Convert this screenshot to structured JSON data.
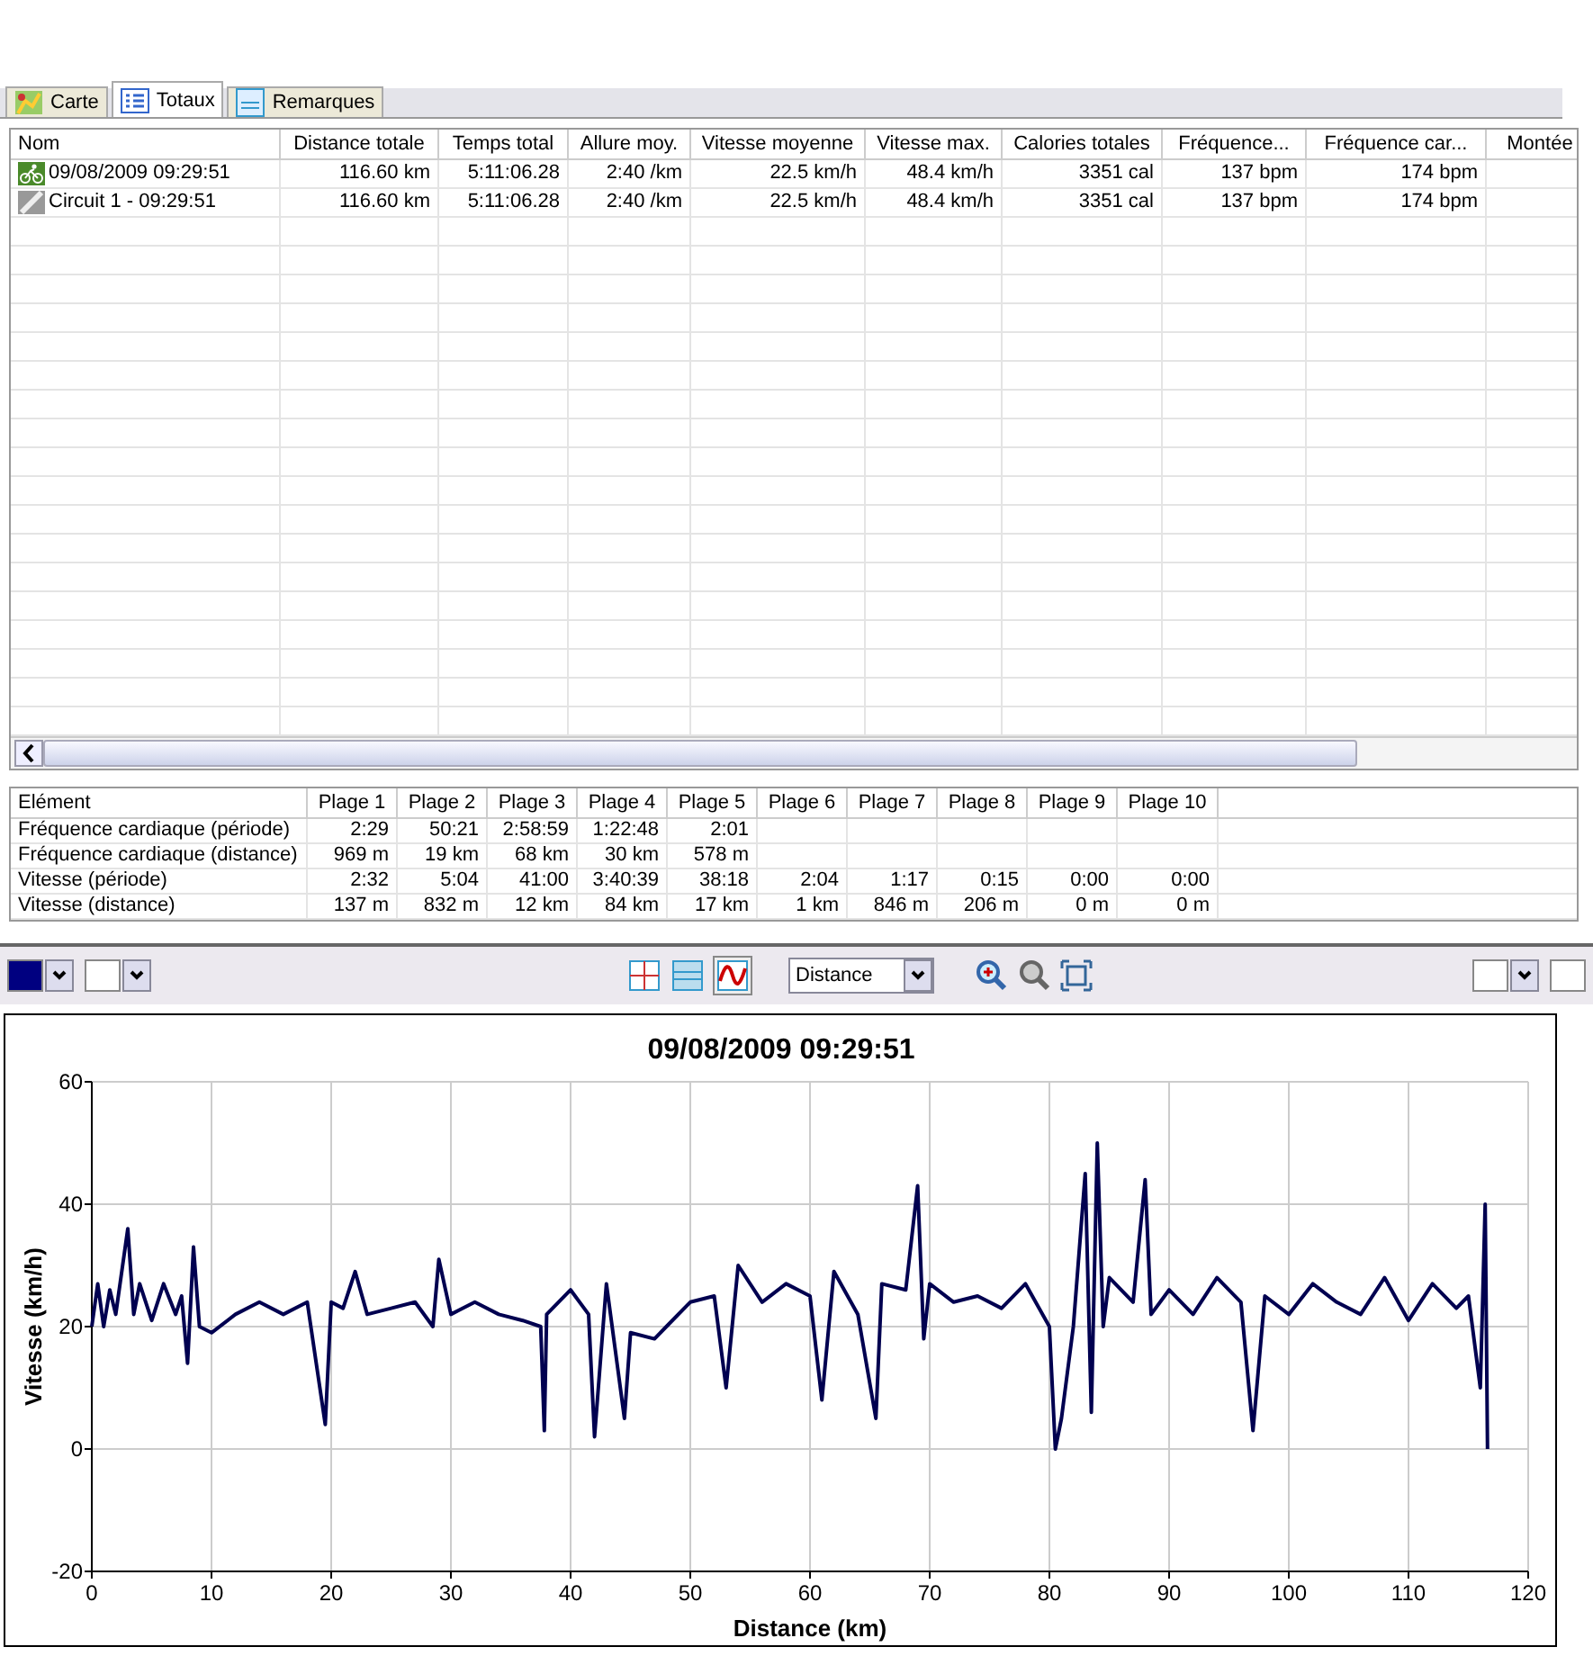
{
  "tabs": [
    {
      "label": "Carte",
      "selected": false
    },
    {
      "label": "Totaux",
      "selected": true
    },
    {
      "label": "Remarques",
      "selected": false
    }
  ],
  "totals_table": {
    "columns": [
      "Nom",
      "Distance totale",
      "Temps total",
      "Allure moy.",
      "Vitesse moyenne",
      "Vitesse max.",
      "Calories totales",
      "Fréquence...",
      "Fréquence car...",
      "Montée"
    ],
    "rows": [
      {
        "kind": "activity",
        "cells": [
          "09/08/2009 09:29:51",
          "116.60 km",
          "5:11:06.28",
          "2:40 /km",
          "22.5 km/h",
          "48.4 km/h",
          "3351 cal",
          "137 bpm",
          "174 bpm"
        ]
      },
      {
        "kind": "lap",
        "cells": [
          "Circuit 1 - 09:29:51",
          "116.60 km",
          "5:11:06.28",
          "2:40 /km",
          "22.5 km/h",
          "48.4 km/h",
          "3351 cal",
          "137 bpm",
          "174 bpm"
        ]
      }
    ]
  },
  "zones_table": {
    "columns": [
      "Elément",
      "Plage 1",
      "Plage 2",
      "Plage 3",
      "Plage 4",
      "Plage 5",
      "Plage 6",
      "Plage 7",
      "Plage 8",
      "Plage 9",
      "Plage 10"
    ],
    "rows": [
      [
        "Fréquence cardiaque (période)",
        "2:29",
        "50:21",
        "2:58:59",
        "1:22:48",
        "2:01"
      ],
      [
        "Fréquence cardiaque (distance)",
        "969 m",
        "19 km",
        "68 km",
        "30 km",
        "578 m"
      ],
      [
        "Vitesse (période)",
        "2:32",
        "5:04",
        "41:00",
        "3:40:39",
        "38:18",
        "2:04",
        "1:17",
        "0:15",
        "0:00",
        "0:00"
      ],
      [
        "Vitesse (distance)",
        "137 m",
        "832 m",
        "12 km",
        "84 km",
        "17 km",
        "1 km",
        "846 m",
        "206 m",
        "0 m",
        "0 m"
      ]
    ]
  },
  "toolbar": {
    "x_axis": "Distance"
  },
  "chart": {
    "title": "09/08/2009 09:29:51",
    "chart_data": {
      "type": "line",
      "xlabel": "Distance (km)",
      "ylabel": "Vitesse (km/h)",
      "xlim": [
        0,
        120
      ],
      "ylim": [
        -20,
        60
      ],
      "grid": true,
      "xticks": [
        0,
        10,
        20,
        30,
        40,
        50,
        60,
        70,
        80,
        90,
        100,
        110,
        120
      ],
      "yticks": [
        -20,
        0,
        20,
        40,
        60
      ],
      "x": [
        0,
        0.5,
        1,
        1.5,
        2,
        3,
        3.5,
        4,
        5,
        6,
        7,
        7.5,
        8,
        8.5,
        9,
        10,
        12,
        14,
        16,
        18,
        19.5,
        20,
        21,
        22,
        23,
        25,
        27,
        28.5,
        29,
        30,
        32,
        34,
        36,
        37.5,
        37.8,
        38,
        40,
        41.5,
        42,
        43,
        44.5,
        45,
        47,
        48,
        50,
        52,
        53,
        54,
        56,
        58,
        60,
        61,
        62,
        64,
        65.5,
        66,
        68,
        69,
        69.5,
        70,
        72,
        74,
        76,
        78,
        80,
        80.5,
        81,
        82,
        83,
        83.5,
        84,
        84.5,
        85,
        87,
        88,
        88.5,
        90,
        92,
        94,
        96,
        97,
        98,
        100,
        102,
        104,
        106,
        108,
        110,
        112,
        114,
        115,
        116,
        116.4,
        116.6
      ],
      "series": [
        {
          "color": "#000050",
          "values": [
            20,
            27,
            20,
            26,
            22,
            36,
            22,
            27,
            21,
            27,
            22,
            25,
            14,
            33,
            20,
            19,
            22,
            24,
            22,
            24,
            4,
            24,
            23,
            29,
            22,
            23,
            24,
            20,
            31,
            22,
            24,
            22,
            21,
            20,
            3,
            22,
            26,
            22,
            2,
            27,
            5,
            19,
            18,
            20,
            24,
            25,
            10,
            30,
            24,
            27,
            25,
            8,
            29,
            22,
            5,
            27,
            26,
            43,
            18,
            27,
            24,
            25,
            23,
            27,
            20,
            0,
            5,
            20,
            45,
            6,
            50,
            20,
            28,
            24,
            44,
            22,
            26,
            22,
            28,
            24,
            3,
            25,
            22,
            27,
            24,
            22,
            28,
            21,
            27,
            23,
            25,
            10,
            40,
            0
          ]
        }
      ]
    }
  }
}
